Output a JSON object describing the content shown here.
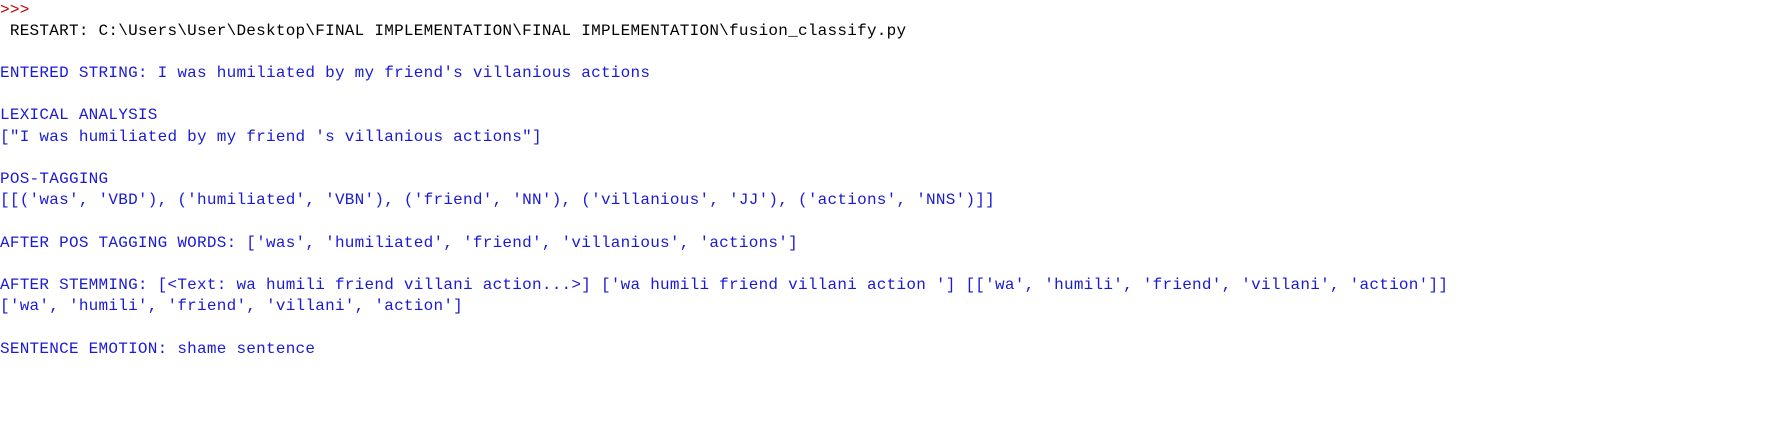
{
  "shell": {
    "prompt": ">>>",
    "restart_line": " RESTART: C:\\Users\\User\\Desktop\\FINAL IMPLEMENTATION\\FINAL IMPLEMENTATION\\fusion_classify.py",
    "output": [
      "ENTERED STRING: I was humiliated by my friend's villanious actions",
      "LEXICAL ANALYSIS",
      "[\"I was humiliated by my friend 's villanious actions\"]",
      "POS-TAGGING",
      "[[('was', 'VBD'), ('humiliated', 'VBN'), ('friend', 'NN'), ('villanious', 'JJ'), ('actions', 'NNS')]]",
      "AFTER POS TAGGING WORDS: ['was', 'humiliated', 'friend', 'villanious', 'actions']",
      "AFTER STEMMING: [<Text: wa humili friend villani action...>] ['wa humili friend villani action '] [['wa', 'humili', 'friend', 'villani', 'action']]",
      "['wa', 'humili', 'friend', 'villani', 'action']",
      "SENTENCE EMOTION: shame sentence"
    ]
  },
  "colors": {
    "prompt": "#c00000",
    "restart": "#000000",
    "output": "#1a1ad6",
    "background": "#ffffff"
  }
}
